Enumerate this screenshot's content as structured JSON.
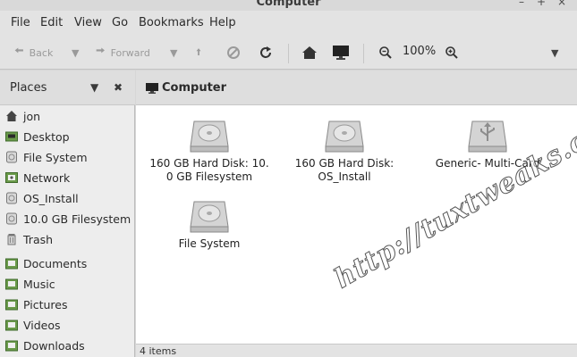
{
  "window": {
    "title": "Computer",
    "controls": [
      "–",
      "+",
      "×"
    ]
  },
  "menu": [
    "File",
    "Edit",
    "View",
    "Go",
    "Bookmarks",
    "Help"
  ],
  "toolbar": {
    "back_label": "Back",
    "forward_label": "Forward",
    "zoom_value": "100%"
  },
  "sidebar": {
    "header": "Places",
    "items": [
      {
        "label": "jon",
        "icon": "home-icon"
      },
      {
        "label": "Desktop",
        "icon": "desktop-folder-icon"
      },
      {
        "label": "File System",
        "icon": "drive-icon"
      },
      {
        "label": "Network",
        "icon": "network-icon"
      },
      {
        "label": "OS_Install",
        "icon": "drive-icon"
      },
      {
        "label": "10.0 GB Filesystem",
        "icon": "drive-icon"
      },
      {
        "label": "Trash",
        "icon": "trash-icon"
      },
      {
        "label": "Documents",
        "icon": "folder-icon"
      },
      {
        "label": "Music",
        "icon": "folder-icon"
      },
      {
        "label": "Pictures",
        "icon": "folder-icon"
      },
      {
        "label": "Videos",
        "icon": "folder-icon"
      },
      {
        "label": "Downloads",
        "icon": "folder-icon"
      }
    ]
  },
  "location": {
    "crumb": "Computer"
  },
  "files": [
    {
      "line1": "160 GB Hard Disk: 10.",
      "line2": "0 GB Filesystem",
      "icon": "hard-disk-icon"
    },
    {
      "line1": "160 GB Hard Disk:",
      "line2": "OS_Install",
      "icon": "hard-disk-icon"
    },
    {
      "line1": "Generic- Multi-Card",
      "line2": "",
      "icon": "usb-drive-icon"
    },
    {
      "line1": "File System",
      "line2": "",
      "icon": "hard-disk-icon"
    }
  ],
  "status": {
    "text": "4 items"
  },
  "watermark": "http://tuxtweaks.com/",
  "colors": {
    "folder_green": "#6a9a4a",
    "view_bg": "#ffffff",
    "chrome_bg": "#e3e3e3"
  }
}
